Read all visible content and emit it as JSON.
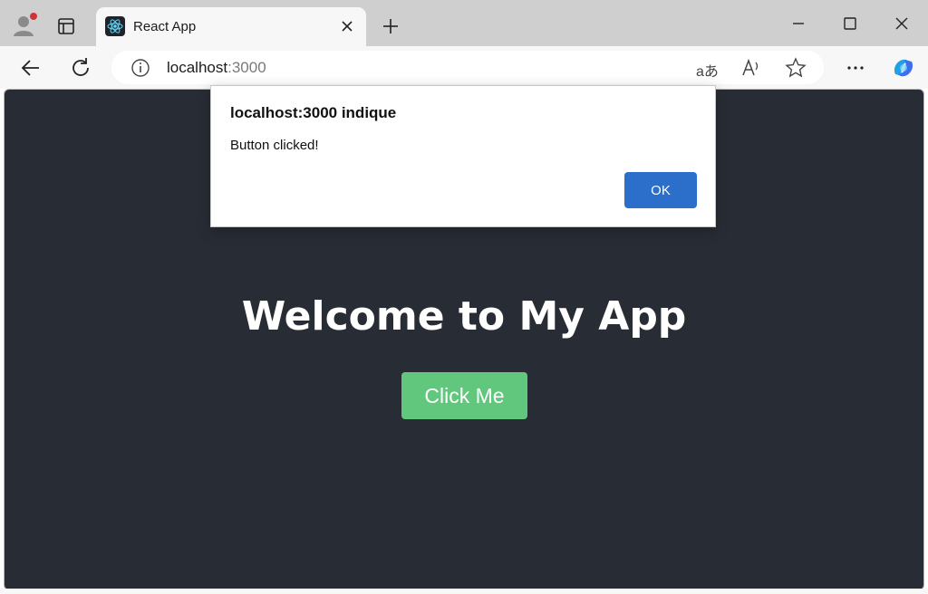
{
  "browser": {
    "tab": {
      "title": "React App",
      "favicon": "react-logo-icon"
    },
    "address": {
      "host": "localhost",
      "port": ":3000"
    },
    "icons": {
      "profile": "profile-icon",
      "tab_actions": "tab-actions-icon",
      "new_tab": "plus-icon",
      "minimize": "minimize-icon",
      "maximize": "maximize-icon",
      "close": "close-icon",
      "back": "back-arrow-icon",
      "refresh": "refresh-icon",
      "info": "info-icon",
      "translate": "aあ",
      "read_aloud": "A⁾",
      "favorite": "star-icon",
      "more": "more-icon",
      "copilot": "copilot-icon"
    }
  },
  "page": {
    "heading": "Welcome to My App",
    "button_label": "Click Me",
    "background_color": "#282c34",
    "button_color": "#61c77d"
  },
  "dialog": {
    "title": "localhost:3000 indique",
    "message": "Button clicked!",
    "ok_label": "OK",
    "ok_color": "#2b6fcb"
  }
}
